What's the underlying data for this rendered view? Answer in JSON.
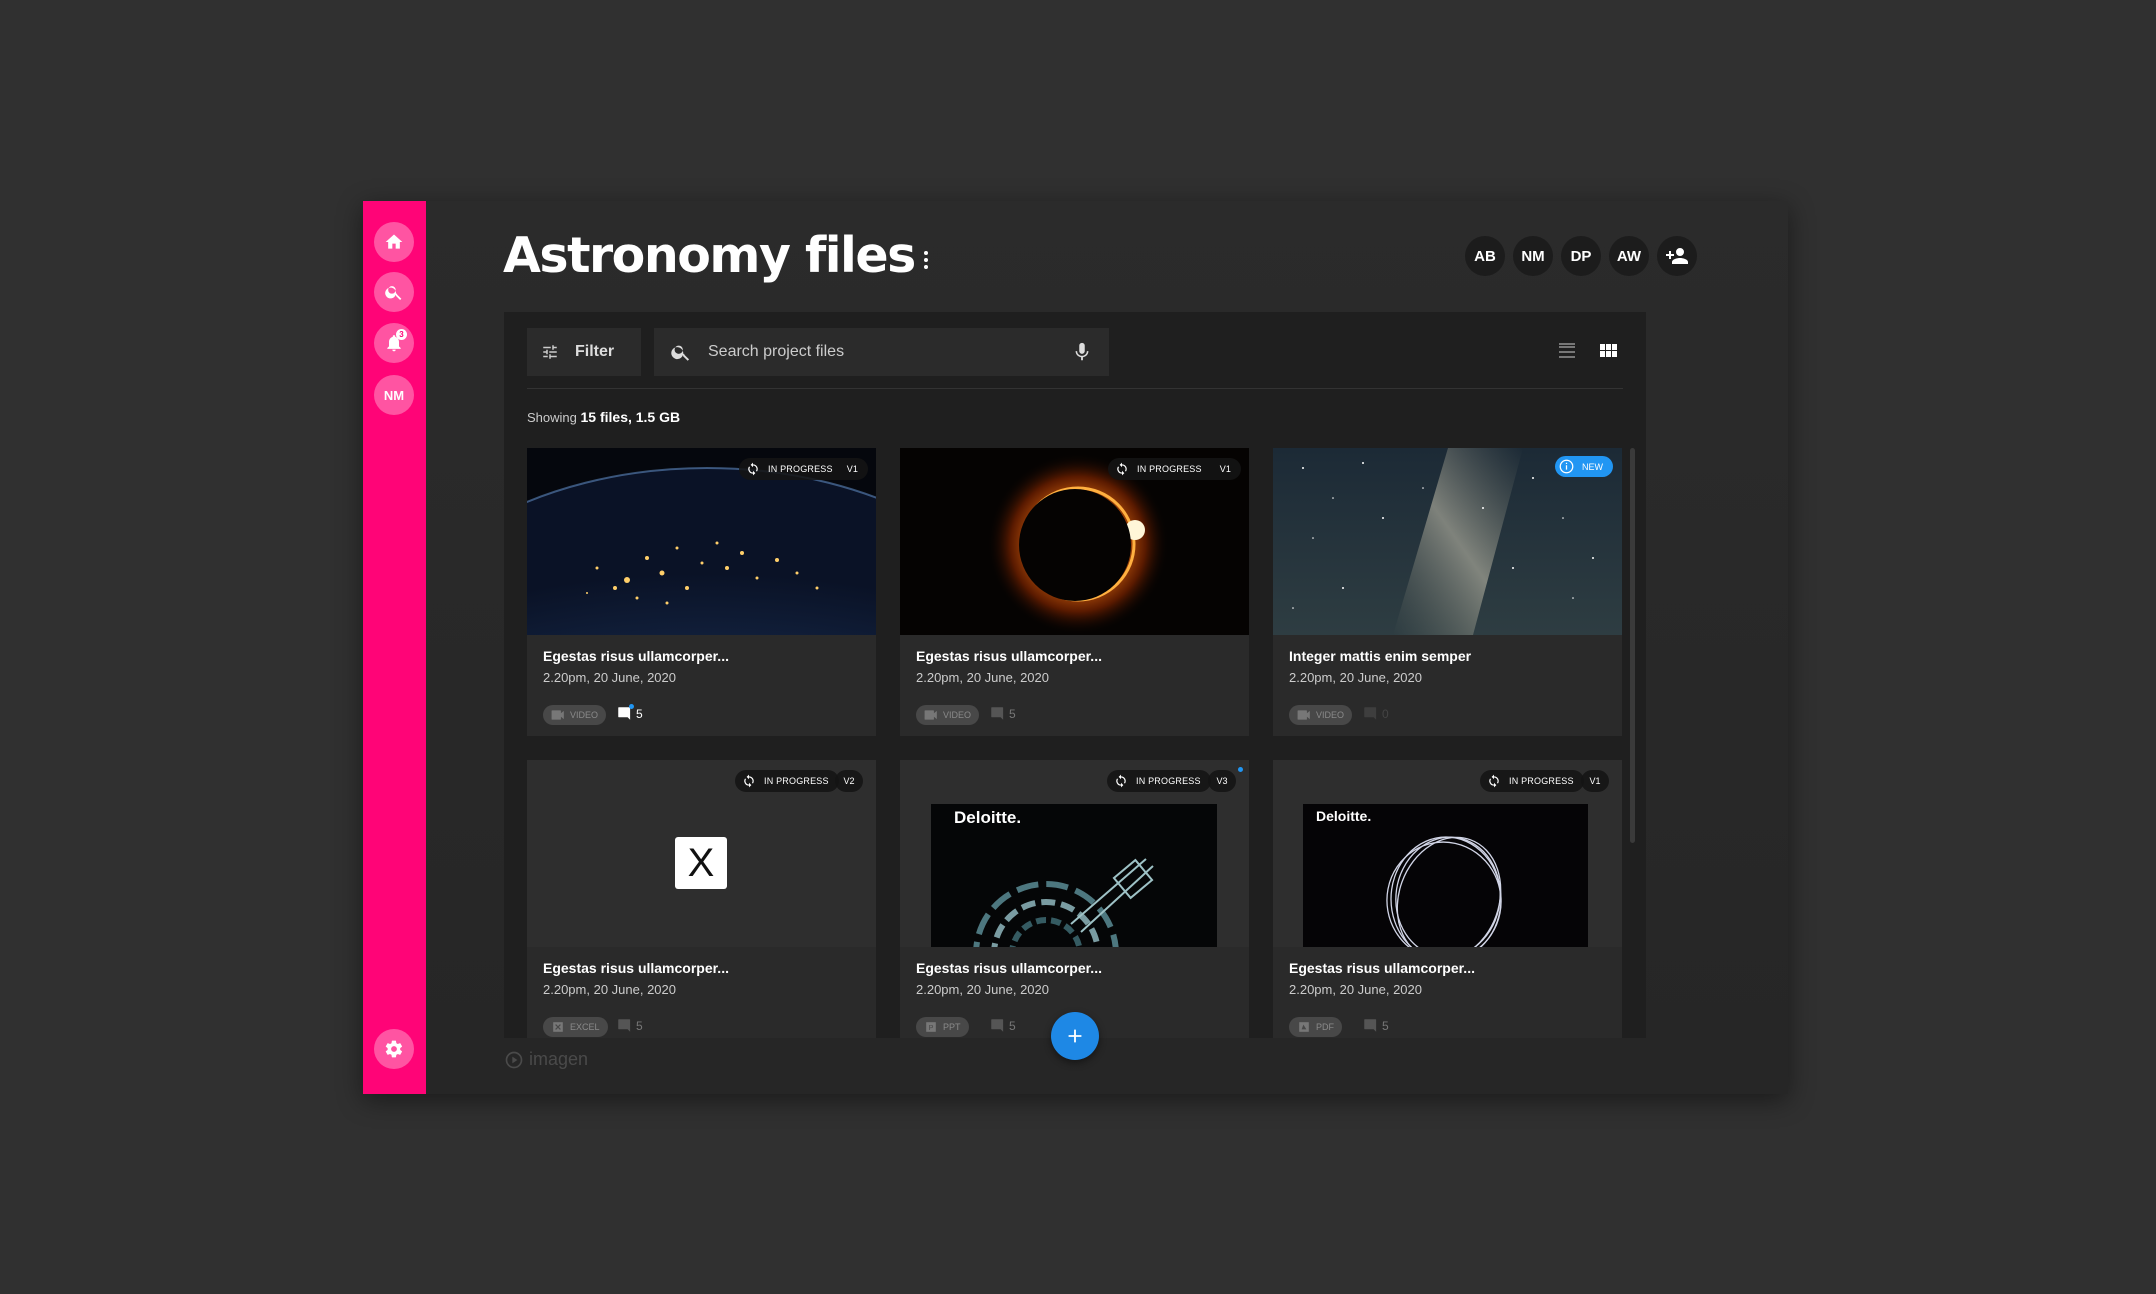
{
  "page": {
    "title": "Astronomy files"
  },
  "sidebar": {
    "profile_initials": "NM",
    "notification_count": "3"
  },
  "collaborators": [
    "AB",
    "NM",
    "DP",
    "AW"
  ],
  "toolbar": {
    "filter_label": "Filter",
    "search_placeholder": "Search project files"
  },
  "summary": {
    "prefix": "Showing",
    "value": "15 files, 1.5 GB"
  },
  "files": [
    {
      "title": "Egestas risus ullamcorper...",
      "date": "2.20pm, 20 June, 2020",
      "type": "VIDEO",
      "status": "IN PROGRESS",
      "version": "V1",
      "comments": "5",
      "thumbnail": "earth-night"
    },
    {
      "title": "Egestas risus ullamcorper...",
      "date": "2.20pm, 20 June, 2020",
      "type": "VIDEO",
      "status": "IN PROGRESS",
      "version": "V1",
      "comments": "5",
      "thumbnail": "solar-eclipse"
    },
    {
      "title": "Integer mattis enim semper",
      "date": "2.20pm, 20 June, 2020",
      "type": "VIDEO",
      "badge": "NEW",
      "comments": "0",
      "thumbnail": "milky-way"
    },
    {
      "title": "Egestas risus ullamcorper...",
      "date": "2.20pm, 20 June, 2020",
      "type": "EXCEL",
      "status": "IN PROGRESS",
      "version": "V2",
      "comments": "5",
      "thumbnail": "excel-icon",
      "thumb_letter": "X"
    },
    {
      "title": "Egestas risus ullamcorper...",
      "date": "2.20pm, 20 June, 2020",
      "type": "PPT",
      "status": "IN PROGRESS",
      "version": "V3",
      "comments": "5",
      "thumbnail": "deloitte-slide",
      "thumb_brand": "Deloitte."
    },
    {
      "title": "Egestas risus ullamcorper...",
      "date": "2.20pm, 20 June, 2020",
      "type": "PDF",
      "status": "IN PROGRESS",
      "version": "V1",
      "comments": "5",
      "thumbnail": "deloitte-ring",
      "thumb_brand": "Deloitte."
    }
  ],
  "brand": {
    "name": "imagen"
  },
  "colors": {
    "sidebar": "#ff0477",
    "accent": "#2196f3",
    "background": "#303030",
    "panel": "#1f1f1f",
    "card": "#2a2a2a"
  }
}
